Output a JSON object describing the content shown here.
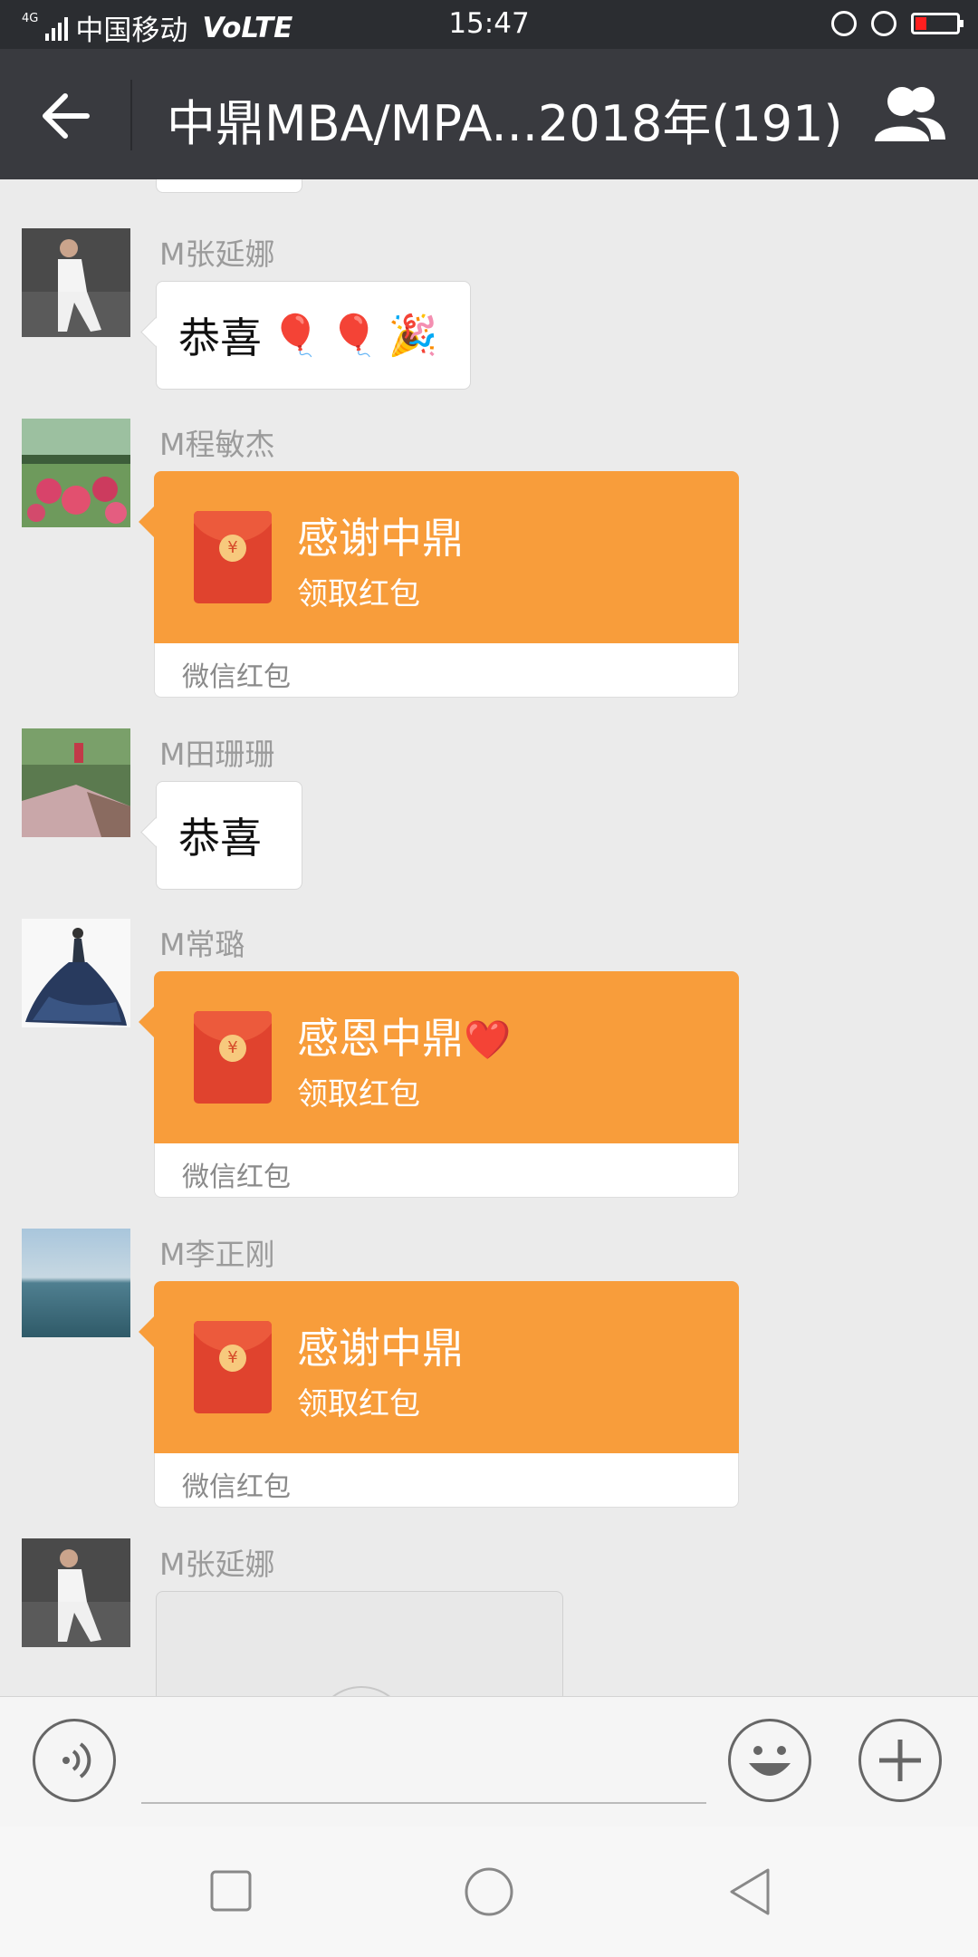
{
  "status_bar": {
    "network_type": "4G",
    "carrier": "中国移动",
    "volte": "VoLTE",
    "time": "15:47",
    "battery_color": "#ff1f1f"
  },
  "header": {
    "title": "中鼎MBA/MPA...2018年(191)",
    "back_icon": "arrow-left-icon",
    "members_icon": "group-icon"
  },
  "messages": [
    {
      "sender": "M张延娜",
      "type": "text",
      "text": "恭喜",
      "emoji": [
        "🎈",
        "🎈",
        "🎉"
      ]
    },
    {
      "sender": "M程敏杰",
      "type": "red_packet",
      "title": "感谢中鼎",
      "subtitle": "领取红包",
      "footer": "微信红包"
    },
    {
      "sender": "M田珊珊",
      "type": "text",
      "text": "恭喜"
    },
    {
      "sender": "M常璐",
      "type": "red_packet",
      "title": "感恩中鼎",
      "title_emoji": "❤️",
      "subtitle": "领取红包",
      "footer": "微信红包"
    },
    {
      "sender": "M李正刚",
      "type": "red_packet",
      "title": "感谢中鼎",
      "subtitle": "领取红包",
      "footer": "微信红包"
    },
    {
      "sender": "M张延娜",
      "type": "image"
    }
  ],
  "colors": {
    "red_packet_orange": "#f89d3b",
    "title_bar": "#393a3f",
    "chat_background": "#ebebeb"
  }
}
